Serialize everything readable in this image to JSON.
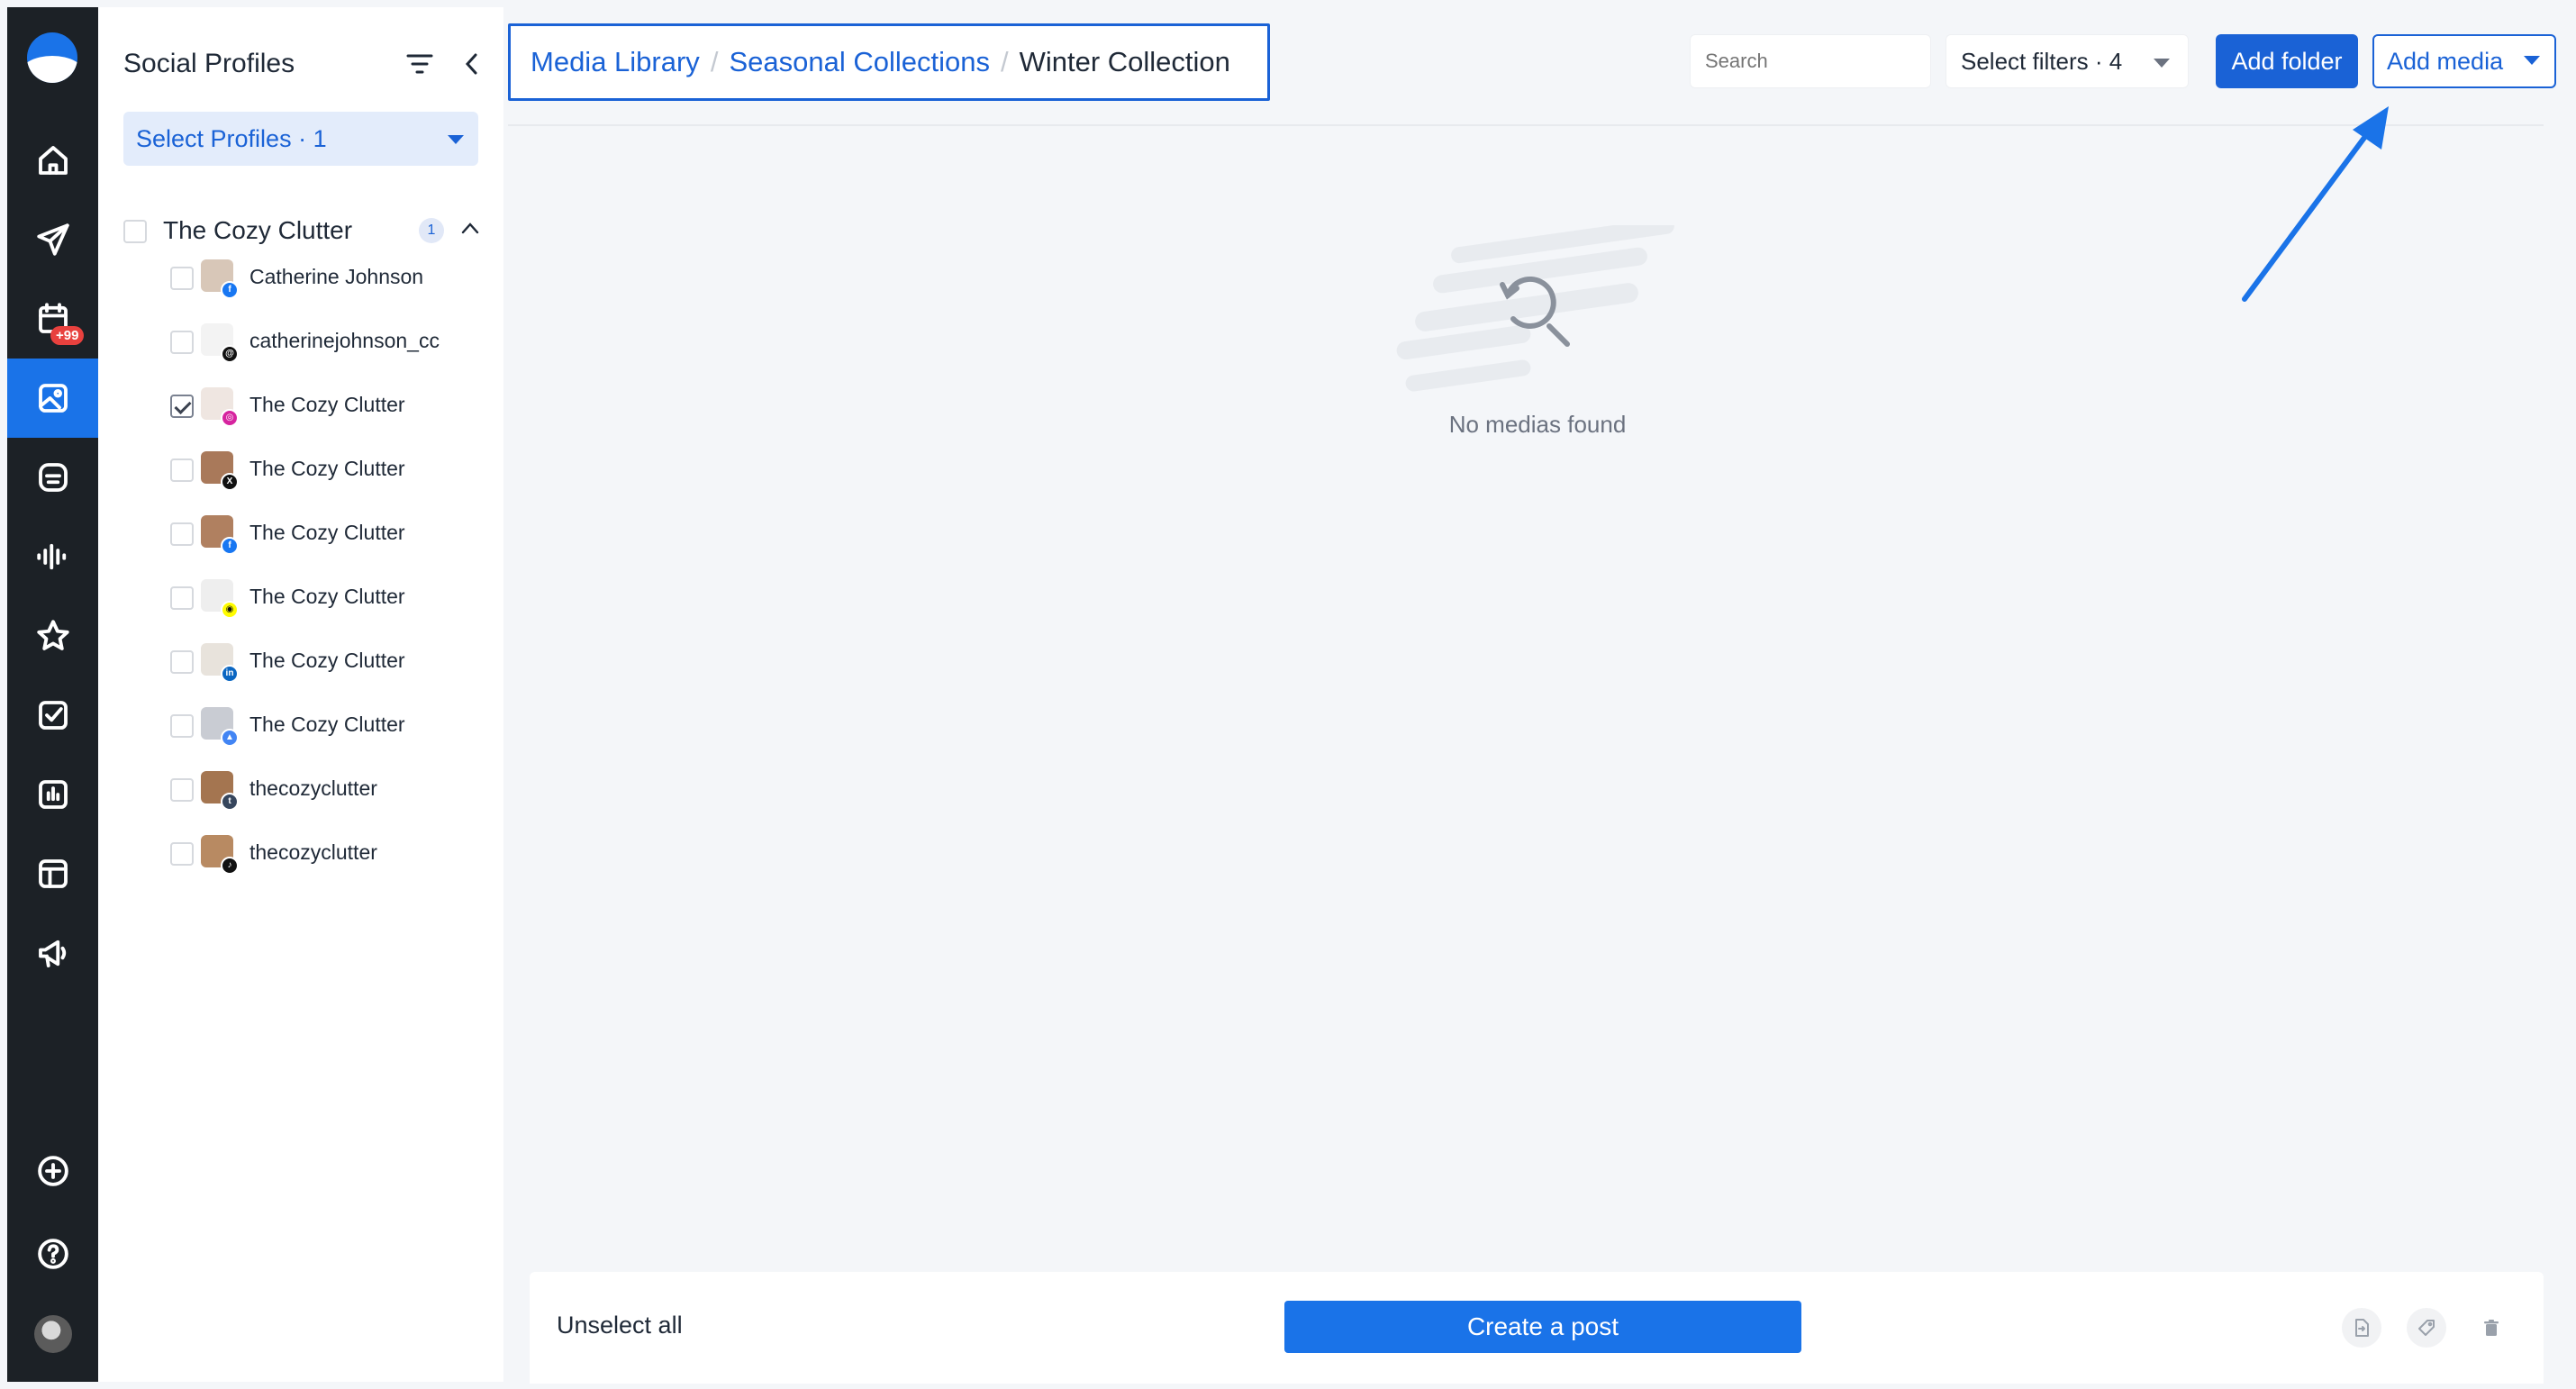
{
  "profiles_panel": {
    "title": "Social Profiles",
    "select_label": "Select Profiles · 1",
    "group": {
      "name": "The Cozy Clutter",
      "count": "1"
    },
    "items": [
      {
        "name": "Catherine Johnson",
        "network": "facebook",
        "checked": false
      },
      {
        "name": "catherinejohnson_cc",
        "network": "threads",
        "checked": false
      },
      {
        "name": "The Cozy Clutter",
        "network": "instagram",
        "checked": true
      },
      {
        "name": "The Cozy Clutter",
        "network": "x",
        "checked": false
      },
      {
        "name": "The Cozy Clutter",
        "network": "facebook",
        "checked": false
      },
      {
        "name": "The Cozy Clutter",
        "network": "snapchat",
        "checked": false
      },
      {
        "name": "The Cozy Clutter",
        "network": "linkedin",
        "checked": false
      },
      {
        "name": "The Cozy Clutter",
        "network": "google-business",
        "checked": false
      },
      {
        "name": "thecozyclutter",
        "network": "tumblr",
        "checked": false
      },
      {
        "name": "thecozyclutter",
        "network": "tiktok",
        "checked": false
      }
    ]
  },
  "rail": {
    "calendar_badge": "+99",
    "icons": [
      "home-icon",
      "send-icon",
      "calendar-icon",
      "media-icon",
      "inbox-icon",
      "audio-icon",
      "star-icon",
      "tasks-icon",
      "analytics-icon",
      "layout-icon",
      "megaphone-icon",
      "add-icon",
      "help-icon"
    ]
  },
  "breadcrumb": {
    "items": [
      "Media Library",
      "Seasonal Collections"
    ],
    "current": "Winter Collection"
  },
  "toolbar": {
    "search_placeholder": "Search",
    "filters_label": "Select filters · 4",
    "add_folder_label": "Add folder",
    "add_media_label": "Add media"
  },
  "empty_state": {
    "message": "No medias found"
  },
  "bottom_bar": {
    "unselect_label": "Unselect all",
    "create_post_label": "Create a post"
  },
  "colors": {
    "accent": "#1a62d6",
    "rail_bg": "#1c2126",
    "badge": "#e8413e"
  }
}
